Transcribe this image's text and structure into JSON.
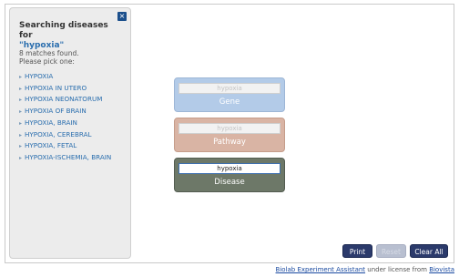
{
  "sidebar": {
    "close_label": "×",
    "heading": "Searching diseases for",
    "term": "\"hypoxia\"",
    "matches_text": "8 matches found.",
    "pick_text": "Please pick one:",
    "bullet": "▸",
    "items": [
      "HYPOXIA",
      "HYPOXIA IN UTERO",
      "HYPOXIA NEONATORUM",
      "HYPOXIA OF BRAIN",
      "HYPOXIA, BRAIN",
      "HYPOXIA, CEREBRAL",
      "HYPOXIA, FETAL",
      "HYPOXIA-ISCHEMIA, BRAIN"
    ]
  },
  "cards": {
    "gene": {
      "placeholder": "hypoxia",
      "label": "Gene",
      "color": "#b3cbe8"
    },
    "pathway": {
      "placeholder": "hypoxia",
      "label": "Pathway",
      "color": "#d9b4a4"
    },
    "disease": {
      "value": "hypoxia",
      "label": "Disease",
      "color": "#6d7868"
    }
  },
  "buttons": {
    "print": "Print",
    "disabled": "Reset",
    "clear": "Clear All"
  },
  "footer": {
    "link1": "Biolab Experiment Assistant",
    "middle": " under license from ",
    "link2": "Biovista"
  },
  "colors": {
    "accent": "#2b3a6b",
    "link": "#2a6eae"
  }
}
